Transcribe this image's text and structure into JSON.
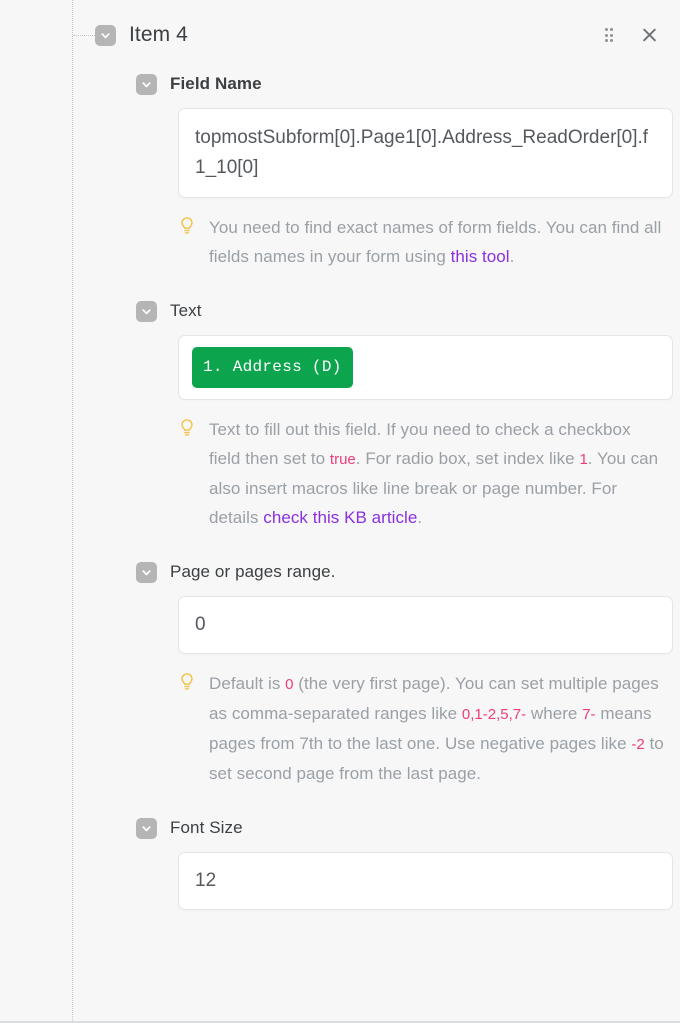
{
  "header": {
    "title": "Item 4",
    "collapse_icon": "chevron-down-icon",
    "drag_icon": "drag-handle-icon",
    "close_icon": "close-icon"
  },
  "fields": [
    {
      "label": "Field Name",
      "bold": true,
      "toggle_icon": "chevron-down-icon",
      "input_kind": "text",
      "value": "topmostSubform[0].Page1[0].Address_ReadOrder[0].f1_10[0]",
      "placeholder": "",
      "hint_icon": "lightbulb-icon",
      "hint": [
        {
          "t": "text",
          "v": "You need to find exact names of form fields. You can find all fields names in your form using "
        },
        {
          "t": "link",
          "v": "this tool"
        },
        {
          "t": "text",
          "v": "."
        }
      ]
    },
    {
      "label": "Text",
      "bold": false,
      "toggle_icon": "chevron-down-icon",
      "input_kind": "token",
      "value": "1. Address (D)",
      "placeholder": "",
      "hint_icon": "lightbulb-icon",
      "hint": [
        {
          "t": "text",
          "v": "Text to fill out this field. If you need to check a checkbox field then set to "
        },
        {
          "t": "code",
          "v": "true"
        },
        {
          "t": "text",
          "v": ". For radio box, set index like "
        },
        {
          "t": "code",
          "v": "1"
        },
        {
          "t": "text",
          "v": ". You can also insert macros like line break or page number. For details "
        },
        {
          "t": "link",
          "v": "check this KB article"
        },
        {
          "t": "text",
          "v": "."
        }
      ]
    },
    {
      "label": "Page or pages range.",
      "bold": false,
      "toggle_icon": "chevron-down-icon",
      "input_kind": "text-single",
      "value": "0",
      "placeholder": "",
      "hint_icon": "lightbulb-icon",
      "hint": [
        {
          "t": "text",
          "v": "Default is "
        },
        {
          "t": "code",
          "v": "0"
        },
        {
          "t": "text",
          "v": " (the very first page). You can set multiple pages as comma-separated ranges like "
        },
        {
          "t": "code",
          "v": "0,1-2,5,7-"
        },
        {
          "t": "text",
          "v": " where "
        },
        {
          "t": "code",
          "v": "7-"
        },
        {
          "t": "text",
          "v": " means pages from 7th to the last one. Use negative pages like "
        },
        {
          "t": "code",
          "v": "-2"
        },
        {
          "t": "text",
          "v": " to set second page from the last page."
        }
      ]
    },
    {
      "label": "Font Size",
      "bold": false,
      "toggle_icon": "chevron-down-icon",
      "input_kind": "text-single",
      "value": "12",
      "placeholder": "",
      "hint_icon": null,
      "hint": []
    }
  ],
  "colors": {
    "token_green": "#0ca54d",
    "link_purple": "#8b2fe0",
    "code_pink": "#ee3d7a",
    "bulb_yellow": "#f5c24a",
    "toggle_gray": "#b5b5b5",
    "hint_gray": "#9aa0a6",
    "page_bg": "#f7f7f7"
  }
}
